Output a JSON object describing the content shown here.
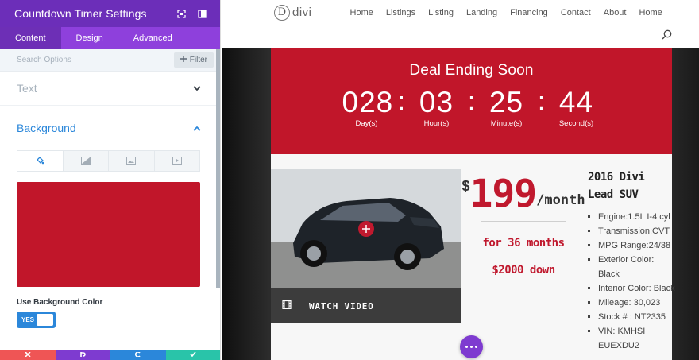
{
  "colors": {
    "panel_header": "#6c2eb9",
    "panel_tabs": "#8e40dc",
    "accent_blue": "#2b87da",
    "background_color": "#c1162a",
    "countdown_bg": "#c1162a",
    "brand_red": "#c0192e"
  },
  "panel": {
    "title": "Countdown Timer Settings",
    "header_icons": [
      "expand-icon",
      "sidebar-layout-icon"
    ],
    "tabs": [
      {
        "label": "Content"
      },
      {
        "label": "Design"
      },
      {
        "label": "Advanced"
      }
    ],
    "search_placeholder": "Search Options",
    "filter_label": "Filter",
    "sections": {
      "text": {
        "title": "Text"
      },
      "background": {
        "title": "Background"
      }
    },
    "background_tabs": [
      "paint-bucket-icon",
      "gradient-icon",
      "image-icon",
      "video-icon"
    ],
    "use_bg_label": "Use Background Color",
    "toggle_text": "YES"
  },
  "site": {
    "logo_text": "divi",
    "nav": [
      "Home",
      "Listings",
      "Listing",
      "Landing",
      "Financing",
      "Contact",
      "About",
      "Home"
    ]
  },
  "countdown": {
    "title": "Deal Ending Soon",
    "separator": ":",
    "units": [
      {
        "value": "028",
        "label": "Day(s)"
      },
      {
        "value": "03",
        "label": "Hour(s)"
      },
      {
        "value": "25",
        "label": "Minute(s)"
      },
      {
        "value": "44",
        "label": "Second(s)"
      }
    ]
  },
  "listing": {
    "watch_label": "WATCH VIDEO",
    "price_currency": "$",
    "price_value": "199",
    "price_unit": "/month",
    "offer_1": "for 36 months",
    "offer_2": "$2000 down",
    "title": "2016 Divi Lead SUV",
    "specs": [
      "Engine:1.5L I-4 cyl",
      "Transmission:CVT",
      "MPG Range:24/38",
      "Exterior Color: Black",
      "Interior Color: Black",
      "Mileage: 30,023",
      "Stock # : NT2335",
      "VIN: KMHSI EUEXDU2"
    ]
  }
}
